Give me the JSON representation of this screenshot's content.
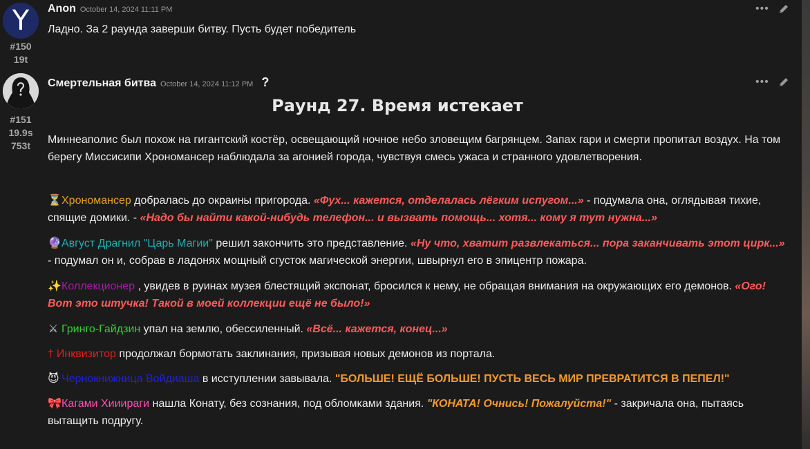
{
  "post1": {
    "author": "Anon",
    "avatar_letter": "Y",
    "timestamp": "October 14, 2024 11:11 PM",
    "number": "#150",
    "tokens": "19t",
    "message": "Ладно. За 2 раунда заверши битву. Пусть будет победитель"
  },
  "post2": {
    "author": "Смертельная битва",
    "timestamp": "October 14, 2024 11:12 PM",
    "help": "?",
    "number": "#151",
    "time_taken": "19.9s",
    "tokens": "753t",
    "title": "Раунд 27. Время истекает",
    "intro": "Миннеаполис был похож на гигантский костёр, освещающий ночное небо зловещим багрянцем. Запах гари и смерти пропитал воздух. На том берегу Миссисипи Хрономансер наблюдала за агонией города, чувствуя смесь ужаса и странного удовлетворения.",
    "p1": {
      "emoji": "⏳",
      "name": "Хрономансер",
      "t1": " добралась до окраины пригорода. ",
      "q1": "«Фух... кажется, отделалась лёгким испугом...»",
      "t2": " - подумала она, оглядывая тихие, спящие домики. - ",
      "q2": "«Надо бы найти какой-нибудь телефон... и вызвать помощь... хотя... кому я тут нужна...»"
    },
    "p2": {
      "emoji": "🔮",
      "name": "Август Драгнил \"Царь Магии\"",
      "t1": " решил закончить это представление. ",
      "q1": "«Ну что, хватит развлекаться... пора заканчивать этот цирк...»",
      "t2": " - подумал он и, собрав в ладонях мощный сгусток магической энергии, швырнул его в эпицентр пожара."
    },
    "p3": {
      "emoji": "✨",
      "name": "Коллекционер",
      "t1": " , увидев в руинах музея блестящий экспонат, бросился к нему, не обращая внимания на окружающих его демонов. ",
      "q1": "«Ого! Вот это штучка! Такой в моей коллекции ещё не было!»"
    },
    "p4": {
      "emoji": "⚔",
      "name": "Гринго-Гайдзин",
      "t1": " упал на землю, обессиленный. ",
      "q1": "«Всё... кажется, конец...»"
    },
    "p5": {
      "emoji": "†",
      "name": "Инквизитор",
      "t1": " продолжал бормотать заклинания, призывая новых демонов из портала."
    },
    "p6": {
      "emoji": "😈",
      "name": "Чернокнижница Войдиаша",
      "t1": " в исступлении завывала. ",
      "q1": "\"БОЛЬШЕ! ЕЩЁ БОЛЬШЕ! ПУСТЬ ВЕСЬ МИР ПРЕВРАТИТСЯ В ПЕПЕЛ!\""
    },
    "p7": {
      "emoji": "🎀",
      "name": "Кагами Хииираги",
      "t1": " нашла Конату, без сознания, под обломками здания. ",
      "q1": "\"КОНАТА! Очнись! Пожалуйста!\"",
      "t2": " - закричала она, пытаясь вытащить подругу."
    }
  },
  "colors": {
    "background": "#1b1b1b",
    "quote_red": "#ff5a5a",
    "quote_orange": "#f59a2a"
  }
}
